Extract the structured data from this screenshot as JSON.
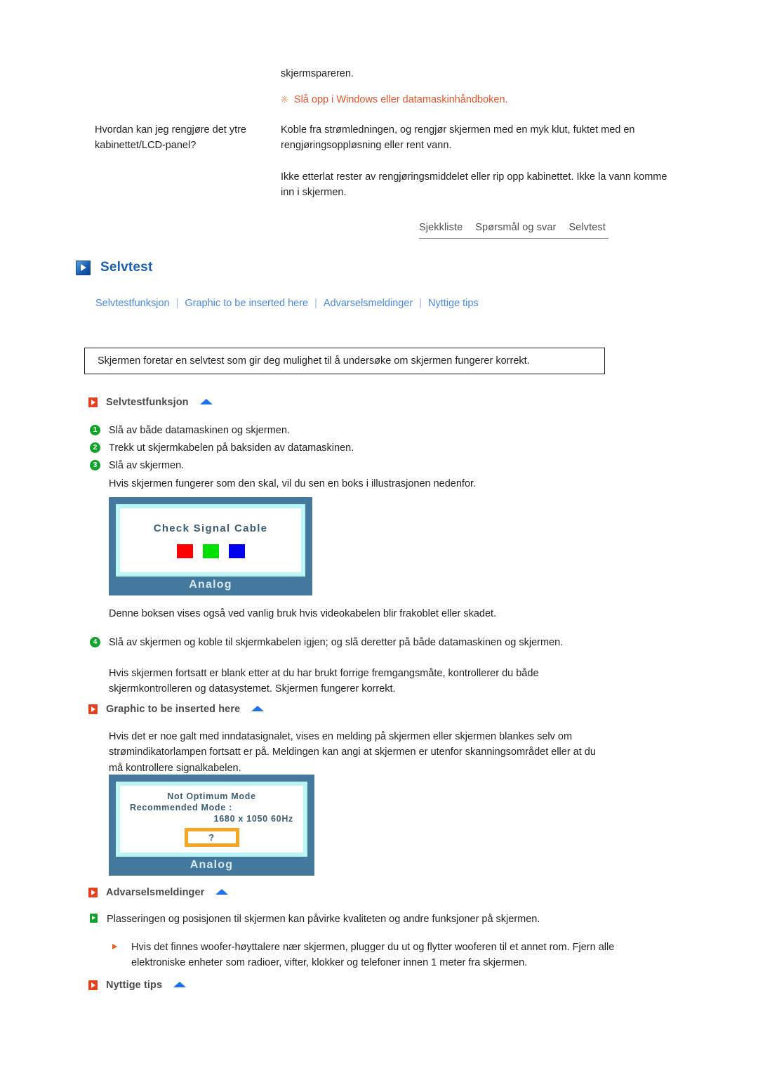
{
  "faq": {
    "continuation_text": "skjermspareren.",
    "note_mark": "※",
    "note_text": "Slå opp i Windows eller datamaskinhåndboken.",
    "question": "Hvordan kan jeg rengjøre det ytre kabinettet/LCD-panel?",
    "answer_p1": "Koble fra strømledningen, og rengjør skjermen med en myk klut, fuktet med en rengjøringsoppløsning eller rent vann.",
    "answer_p2": "Ikke etterlat rester av rengjøringsmiddelet eller rip opp kabinettet. Ikke la vann komme inn i skjermen."
  },
  "tabs": [
    {
      "label": "Sjekkliste"
    },
    {
      "label": "Spørsmål og svar"
    },
    {
      "label": "Selvtest"
    }
  ],
  "section": {
    "title": "Selvtest",
    "icon": "blue-play-icon"
  },
  "sublinks": [
    {
      "label": "Selvtestfunksjon"
    },
    {
      "label": "Graphic to be inserted here"
    },
    {
      "label": "Advarselsmeldinger"
    },
    {
      "label": "Nyttige tips"
    }
  ],
  "sublink_separator": "|",
  "intro_box": {
    "text": "Skjermen foretar en selvtest som gir deg mulighet til å undersøke om skjermen fungerer korrekt."
  },
  "selftest": {
    "heading": "Selvtestfunksjon",
    "steps": [
      {
        "num": "1",
        "text": "Slå av både datamaskinen og skjermen."
      },
      {
        "num": "2",
        "text": "Trekk ut skjermkabelen på baksiden av datamaskinen."
      },
      {
        "num": "3",
        "text": "Slå av skjermen."
      }
    ],
    "after_steps_text": "Hvis skjermen fungerer som den skal, vil du sen en boks i illustrasjonen nedenfor.",
    "caption_text": "Denne boksen vises også ved vanlig bruk hvis videokabelen blir frakoblet eller skadet.",
    "step4": {
      "num": "4",
      "text": "Slå av skjermen og koble til skjermkabelen igjen; og slå deretter på både datamaskinen og skjermen."
    },
    "step4_follow": "Hvis skjermen fortsatt er blank etter at du har brukt forrige fremgangsmåte, kontrollerer du både skjermkontrolleren og datasystemet. Skjermen fungerer korrekt."
  },
  "monitor_1": {
    "osd_title": "Check Signal Cable",
    "label": "Analog",
    "colors": {
      "bezel": "#44789c",
      "inner_border": "#bdf4f6",
      "red": "#ff0000",
      "green": "#00e000",
      "blue": "#0000ee"
    }
  },
  "graphic_section": {
    "heading": "Graphic to be inserted here",
    "paragraph": "Hvis det er noe galt med inndatasignalet, vises en melding på skjermen eller skjermen blankes selv om strømindikatorlampen fortsatt er på. Meldingen kan angi at skjermen er utenfor skanningsområdet eller at du må kontrollere signalkabelen."
  },
  "monitor_2": {
    "line1": "Not Optimum Mode",
    "line2": "Recommended Mode :",
    "line3": "1680 x 1050   60Hz",
    "qbox": "?",
    "label": "Analog",
    "colors": {
      "qbox_border": "#f5a623"
    }
  },
  "warnings_section": {
    "heading": "Advarselsmeldinger",
    "bullet": "Plasseringen og posisjonen til skjermen kan påvirke kvaliteten og andre funksjoner på skjermen.",
    "subbullet": "Hvis det finnes woofer-høyttalere nær skjermen, plugger du ut og flytter wooferen til et annet rom. Fjern alle elektroniske enheter som radioer, vifter, klokker og telefoner innen 1 meter fra skjermen."
  },
  "tips_section": {
    "heading": "Nyttige tips"
  }
}
